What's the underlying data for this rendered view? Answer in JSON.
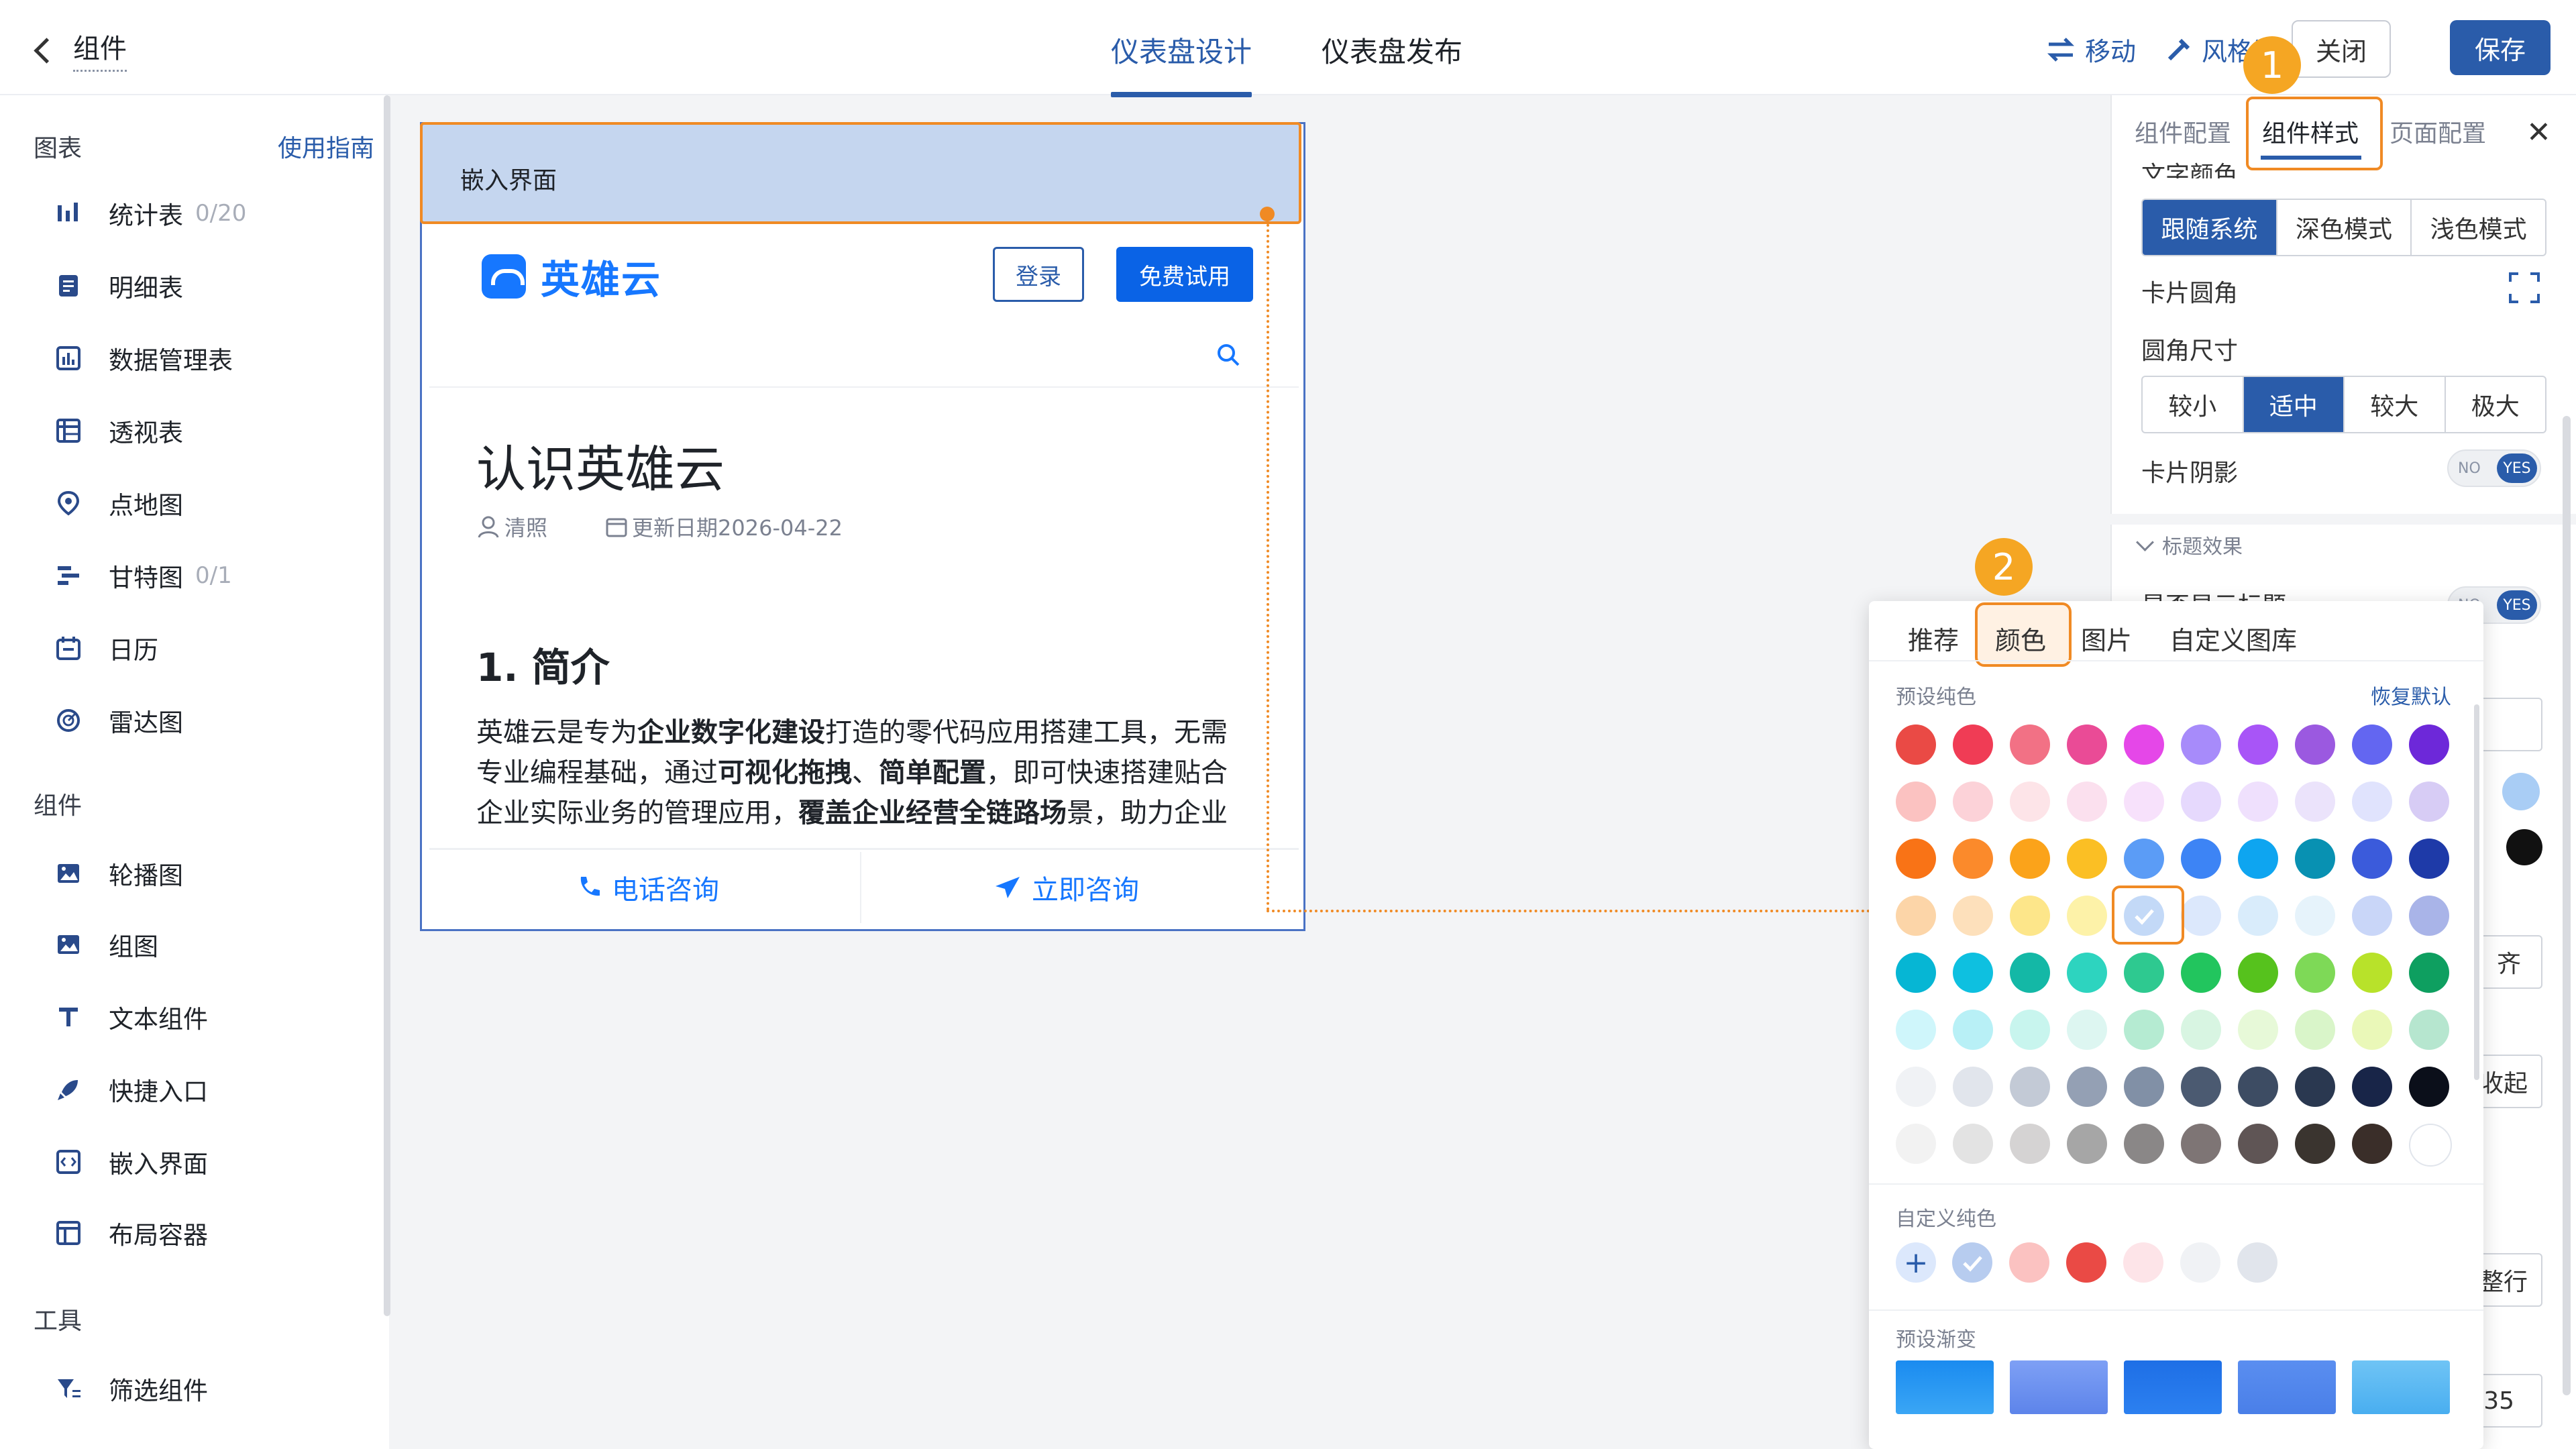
{
  "header": {
    "back_label": "组件",
    "tabs": [
      {
        "label": "仪表盘设计",
        "active": true
      },
      {
        "label": "仪表盘发布",
        "active": false
      }
    ],
    "move_label": "移动",
    "style_label": "风格设",
    "close_label": "关闭",
    "save_label": "保存"
  },
  "sidebar": {
    "charts_title": "图表",
    "guide_link": "使用指南",
    "charts": [
      {
        "label": "统计表",
        "count": "0/20",
        "icon": "bar-chart-icon"
      },
      {
        "label": "明细表",
        "count": "",
        "icon": "detail-table-icon"
      },
      {
        "label": "数据管理表",
        "count": "",
        "icon": "data-manage-icon"
      },
      {
        "label": "透视表",
        "count": "",
        "icon": "pivot-table-icon"
      },
      {
        "label": "点地图",
        "count": "",
        "icon": "map-pin-icon"
      },
      {
        "label": "甘特图",
        "count": "0/1",
        "icon": "gantt-icon"
      },
      {
        "label": "日历",
        "count": "",
        "icon": "calendar-icon"
      },
      {
        "label": "雷达图",
        "count": "",
        "icon": "radar-icon"
      }
    ],
    "components_title": "组件",
    "components": [
      {
        "label": "轮播图",
        "icon": "carousel-icon"
      },
      {
        "label": "组图",
        "icon": "image-group-icon"
      },
      {
        "label": "文本组件",
        "icon": "text-icon"
      },
      {
        "label": "快捷入口",
        "icon": "rocket-icon"
      },
      {
        "label": "嵌入界面",
        "icon": "embed-icon"
      },
      {
        "label": "布局容器",
        "icon": "layout-icon"
      }
    ],
    "tools_title": "工具",
    "tools": [
      {
        "label": "筛选组件",
        "icon": "filter-icon"
      }
    ]
  },
  "card": {
    "title": "嵌入界面",
    "brand": "英雄云",
    "login": "登录",
    "trial": "免费试用",
    "article_title": "认识英雄云",
    "author": "清照",
    "date": "更新日期2026-04-22",
    "heading": "1. 简介",
    "para": [
      {
        "t": "英雄云是专为",
        "b": false
      },
      {
        "t": "企业数字化建设",
        "b": true
      },
      {
        "t": "打造的零代码应用搭建工具，无需专业编程基础，通过",
        "b": false
      },
      {
        "t": "可视化拖拽",
        "b": true
      },
      {
        "t": "、",
        "b": false
      },
      {
        "t": "简单配置",
        "b": true
      },
      {
        "t": "，即可快速搭建贴合企业实际业务的管理应用，",
        "b": false
      },
      {
        "t": "覆盖企业经营全链路场",
        "b": true
      },
      {
        "t": "景，助力企业提升管理效率，缩短数字化落地周期。",
        "b": false
      }
    ],
    "phone_btn": "电话咨询",
    "consult_btn": "立即咨询"
  },
  "right_panel": {
    "tabs": [
      {
        "label": "组件配置"
      },
      {
        "label": "组件样式",
        "active": true
      },
      {
        "label": "页面配置"
      }
    ],
    "text_color_label": "文字颜色",
    "text_modes": [
      {
        "label": "跟随系统",
        "selected": true
      },
      {
        "label": "深色模式"
      },
      {
        "label": "浅色模式"
      }
    ],
    "card_radius_label": "卡片圆角",
    "radius_size_label": "圆角尺寸",
    "radius_sizes": [
      {
        "label": "较小"
      },
      {
        "label": "适中",
        "selected": true
      },
      {
        "label": "较大"
      },
      {
        "label": "极大"
      }
    ],
    "card_shadow_label": "卡片阴影",
    "toggle_no": "NO",
    "toggle_yes": "YES",
    "title_effect_label": "标题效果",
    "show_title_label": "是否显示标题",
    "align_partial": "齐",
    "collapse_partial": "收起",
    "wrap_partial": "整行",
    "size_value": "35"
  },
  "badges": {
    "one": "1",
    "two": "2"
  },
  "color_popup": {
    "tabs": [
      {
        "label": "推荐"
      },
      {
        "label": "颜色",
        "active": true
      },
      {
        "label": "图片"
      },
      {
        "label": "自定义图库"
      }
    ],
    "preset_label": "预设纯色",
    "restore_label": "恢复默认",
    "preset_colors": [
      [
        "#ea4a45",
        "#f03c55",
        "#f27185",
        "#ea4b96",
        "#e547e8",
        "#a78bfa",
        "#a855f7",
        "#9b59e0",
        "#6366f1",
        "#6d28d9"
      ],
      [
        "#fbc2c1",
        "#fcd2d8",
        "#fde4e8",
        "#fbe0ee",
        "#f7e1fb",
        "#e6d9fd",
        "#efe0fd",
        "#ebe3fb",
        "#e0e3fd",
        "#d7ccf5"
      ],
      [
        "#f97316",
        "#fb8a2b",
        "#fba31a",
        "#fbbf24",
        "#5b9cf6",
        "#3d84f5",
        "#0ea5f0",
        "#0891b2",
        "#3b5bdb",
        "#1e3aa8"
      ],
      [
        "#fcd5a8",
        "#fde0bb",
        "#fde68a",
        "#fdf2a8",
        "#c3d9f7",
        "#dce8fc",
        "#d9ecfb",
        "#e6f3fb",
        "#c9d6f8",
        "#a9b4e8"
      ],
      [
        "#06b6d4",
        "#0ec0e0",
        "#14b8a6",
        "#2dd4bf",
        "#2ec990",
        "#22c55e",
        "#56c21d",
        "#7ed957",
        "#b8e22a",
        "#0e9f60"
      ],
      [
        "#cff6fb",
        "#b8f0f6",
        "#c8f5ee",
        "#ddf6f1",
        "#b5ebd2",
        "#d8f5e2",
        "#e7f9d8",
        "#d9f5c9",
        "#eaf8b8",
        "#b6e6cf"
      ],
      [
        "#f0f2f5",
        "#e1e5ec",
        "#c3cad6",
        "#94a0b4",
        "#8190a6",
        "#4b5a71",
        "#3d4c63",
        "#2a3850",
        "#182548",
        "#0b0f1a"
      ],
      [
        "#f2f2f2",
        "#e3e3e3",
        "#d5d3d3",
        "#a6a6a6",
        "#8a8787",
        "#7e7575",
        "#5f5555",
        "#3a342f",
        "#3a2e29",
        "#ffffff"
      ]
    ],
    "selected_swatch": "#c3d9f7",
    "custom_label": "自定义纯色",
    "custom_colors": [
      "#dce8fc",
      "#fbc2c1",
      "#ea4a45",
      "#fde4e8",
      "#f0f2f5",
      "#e1e5ec"
    ],
    "gradient_label": "预设渐变",
    "gradients": [
      [
        "#1a8bf0",
        "#3aa6f5"
      ],
      [
        "#7ea0f5",
        "#5d84ea"
      ],
      [
        "#1e6fe6",
        "#2c80f0"
      ],
      [
        "#5a8ef0",
        "#4a7fe8"
      ],
      [
        "#6fc4f5",
        "#49aef0"
      ]
    ]
  },
  "right_edge_colors": [
    "#a9cdf5",
    "#111111"
  ]
}
